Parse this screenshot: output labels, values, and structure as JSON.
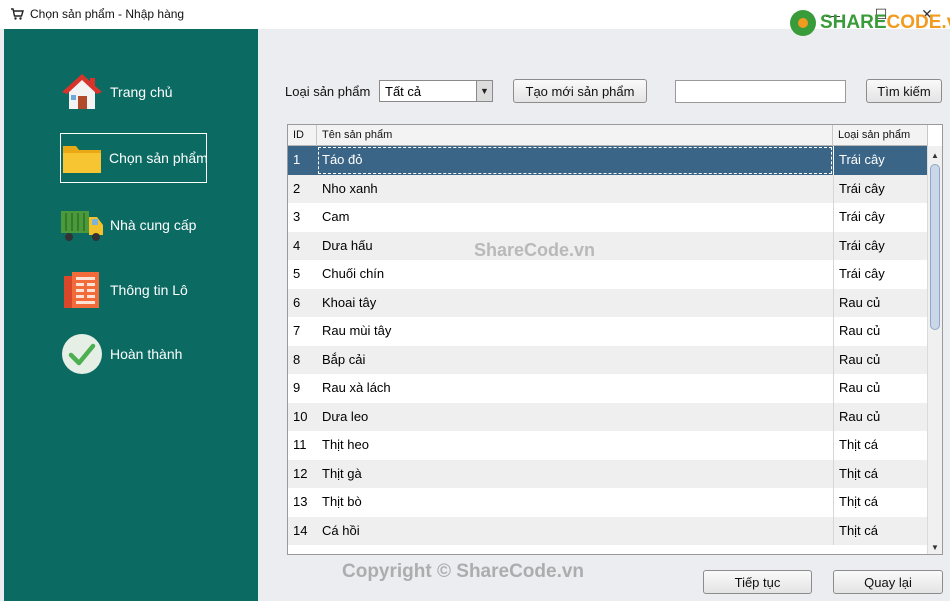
{
  "window": {
    "title": "Chọn sản phẩm - Nhập hàng",
    "minimize_glyph": "—",
    "maximize_glyph": "☐",
    "close_glyph": "✕"
  },
  "brand": {
    "prefix": "SHARE",
    "suffix": "CODE.vn"
  },
  "sidebar": {
    "items": [
      {
        "label": "Trang chủ",
        "icon": "house-icon"
      },
      {
        "label": "Chọn sản phẩm",
        "icon": "folder-icon"
      },
      {
        "label": "Nhà cung cấp",
        "icon": "truck-icon"
      },
      {
        "label": "Thông tin Lô",
        "icon": "document-icon"
      },
      {
        "label": "Hoàn thành",
        "icon": "checkmark-icon"
      }
    ]
  },
  "toolbar": {
    "filter_label": "Loại sản phẩm",
    "filter_value": "Tất cả",
    "create_label": "Tạo mới sản phẩm",
    "search_value": "",
    "search_label": "Tìm kiếm"
  },
  "table": {
    "headers": [
      "ID",
      "Tên sản phẩm",
      "Loại sản phẩm"
    ],
    "rows": [
      [
        "1",
        "Táo đỏ",
        "Trái cây"
      ],
      [
        "2",
        "Nho xanh",
        "Trái cây"
      ],
      [
        "3",
        "Cam",
        "Trái cây"
      ],
      [
        "4",
        "Dưa hấu",
        "Trái cây"
      ],
      [
        "5",
        "Chuối chín",
        "Trái cây"
      ],
      [
        "6",
        "Khoai tây",
        "Rau củ"
      ],
      [
        "7",
        "Rau mùi tây",
        "Rau củ"
      ],
      [
        "8",
        "Bắp cải",
        "Rau củ"
      ],
      [
        "9",
        "Rau xà lách",
        "Rau củ"
      ],
      [
        "10",
        "Dưa leo",
        "Rau củ"
      ],
      [
        "11",
        "Thịt heo",
        "Thịt cá"
      ],
      [
        "12",
        "Thịt gà",
        "Thịt cá"
      ],
      [
        "13",
        "Thịt bò",
        "Thịt cá"
      ],
      [
        "14",
        "Cá hồi",
        "Thịt cá"
      ]
    ],
    "selected_row": 1
  },
  "watermarks": {
    "center": "ShareCode.vn",
    "bottom": "Copyright © ShareCode.vn"
  },
  "footer": {
    "next_label": "Tiếp tục",
    "back_label": "Quay lại"
  },
  "colors": {
    "sidebar": "#0b6b63",
    "selected_row": "#3b6587"
  }
}
